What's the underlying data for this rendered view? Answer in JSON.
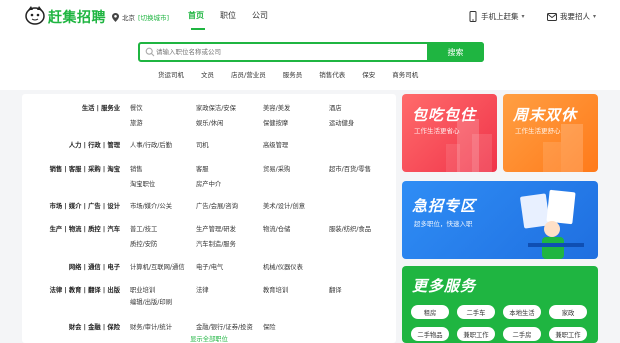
{
  "header": {
    "brand": "赶集招聘",
    "city": "北京",
    "switch_city": "[切换城市]",
    "nav": [
      "首页",
      "职位",
      "公司"
    ],
    "mobile": "手机上赶集",
    "post_job": "我要招人"
  },
  "search": {
    "placeholder": "请输入职位名称或公司",
    "button": "搜索",
    "hotwords": [
      "货运司机",
      "文员",
      "店员/营业员",
      "服务员",
      "销售代表",
      "保安",
      "商务司机"
    ]
  },
  "categories": [
    {
      "head": "生活 | 服务业",
      "items": [
        [
          "餐饮",
          "家政保洁/安保",
          "美容/美发",
          "酒店"
        ],
        [
          "旅游",
          "娱乐/休闲",
          "保健按摩",
          "运动健身"
        ]
      ]
    },
    {
      "head": "人力 | 行政 | 管理",
      "items": [
        [
          "人事/行政/后勤",
          "司机",
          "高级管理",
          ""
        ]
      ]
    },
    {
      "head": "销售 | 客服 | 采购 | 淘宝",
      "items": [
        [
          "销售",
          "客服",
          "贸易/采购",
          "超市/百货/零售"
        ],
        [
          "淘宝职位",
          "房产中介",
          "",
          ""
        ]
      ]
    },
    {
      "head": "市场 | 媒介 | 广告 | 设计",
      "items": [
        [
          "市场/媒介/公关",
          "广告/会展/咨询",
          "美术/设计/创意",
          ""
        ]
      ]
    },
    {
      "head": "生产 | 物流 | 质控 | 汽车",
      "items": [
        [
          "普工/技工",
          "生产管理/研发",
          "物流/仓储",
          "服装/纺织/食品"
        ],
        [
          "质控/安防",
          "汽车制造/服务",
          "",
          ""
        ]
      ]
    },
    {
      "head": "网络 | 通信 | 电子",
      "items": [
        [
          "计算机/互联网/通信",
          "电子/电气",
          "机械/仪器仪表",
          ""
        ]
      ]
    },
    {
      "head": "法律 | 教育 | 翻译 | 出版",
      "items": [
        [
          "职业培训",
          "法律",
          "教育培训",
          "翻译"
        ],
        [
          "编辑/出版/印刷",
          "",
          "",
          ""
        ]
      ]
    },
    {
      "head": "财会 | 金融 | 保险",
      "items": [
        [
          "财务/审计/统计",
          "金融/银行/证券/投资",
          "保险",
          ""
        ]
      ]
    }
  ],
  "more_jobs": "显示全部职位",
  "banners": {
    "b1": {
      "title": "包吃包住",
      "sub": "工作生活更省心"
    },
    "b2": {
      "title": "周末双休",
      "sub": "工作生活更舒心"
    },
    "b3": {
      "title": "急招专区",
      "sub": "超多职位，快速入职"
    },
    "b4": {
      "title": "更多服务",
      "services": [
        "租房",
        "二手车",
        "本地生活",
        "家政",
        "二手物品",
        "兼职工作",
        "二手房",
        "兼职工作"
      ]
    }
  },
  "colors": {
    "brand": "#1fb541",
    "red": "#f0344a",
    "orange": "#ff7a1a",
    "blue": "#1f6fe0"
  }
}
